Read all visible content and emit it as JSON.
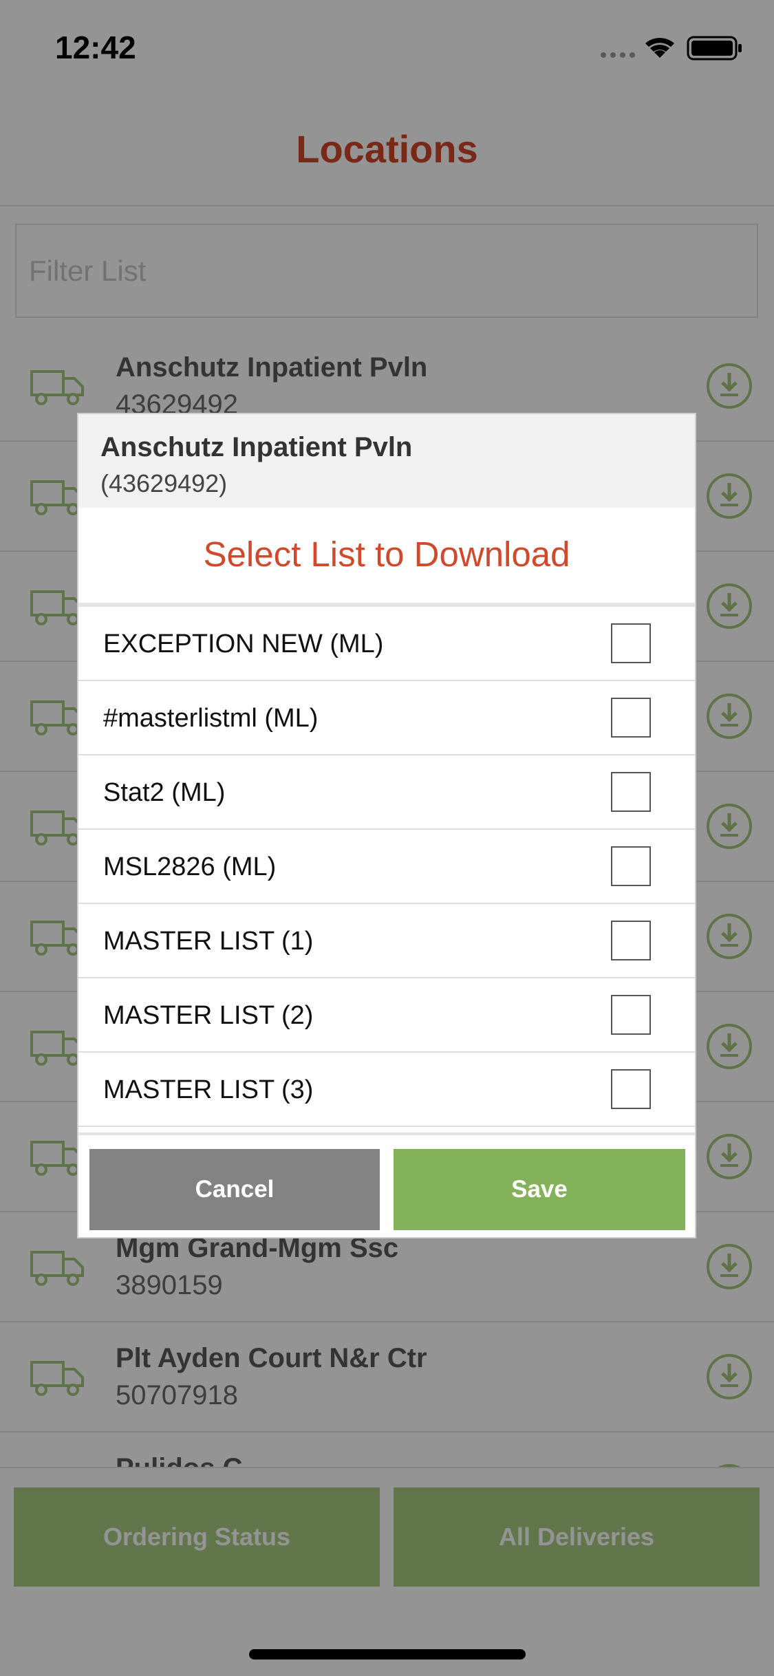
{
  "status_bar": {
    "time": "12:42",
    "icons": [
      "signal-dots-icon",
      "wifi-icon",
      "battery-icon"
    ]
  },
  "header": {
    "title": "Locations"
  },
  "filter": {
    "placeholder": "Filter List",
    "value": ""
  },
  "locations": [
    {
      "name": "Anschutz Inpatient Pvln",
      "id": "43629492"
    },
    {
      "name": "",
      "id": ""
    },
    {
      "name": "",
      "id": ""
    },
    {
      "name": "",
      "id": ""
    },
    {
      "name": "",
      "id": ""
    },
    {
      "name": "",
      "id": ""
    },
    {
      "name": "",
      "id": ""
    },
    {
      "name": "",
      "id": ""
    },
    {
      "name": "Mgm Grand-Mgm Ssc",
      "id": "3890159"
    },
    {
      "name": "Plt Ayden Court N&r Ctr",
      "id": "50707918"
    },
    {
      "name": "Pulidos C",
      "id": ""
    }
  ],
  "bottom_bar": {
    "ordering_status": "Ordering Status",
    "all_deliveries": "All Deliveries"
  },
  "dialog": {
    "location_name": "Anschutz Inpatient Pvln",
    "location_id": "(43629492)",
    "title": "Select List to Download",
    "items": [
      {
        "label": "EXCEPTION NEW (ML)",
        "checked": false
      },
      {
        "label": "#masterlistml (ML)",
        "checked": false
      },
      {
        "label": "Stat2 (ML)",
        "checked": false
      },
      {
        "label": "MSL2826 (ML)",
        "checked": false
      },
      {
        "label": "MASTER LIST (1)",
        "checked": false
      },
      {
        "label": "MASTER LIST (2)",
        "checked": false
      },
      {
        "label": "MASTER LIST (3)",
        "checked": false
      }
    ],
    "cancel_label": "Cancel",
    "save_label": "Save"
  },
  "colors": {
    "accent": "#d2482a",
    "green": "#84b25b",
    "green_light": "#a9cc84",
    "cancel_gray": "#838383"
  }
}
